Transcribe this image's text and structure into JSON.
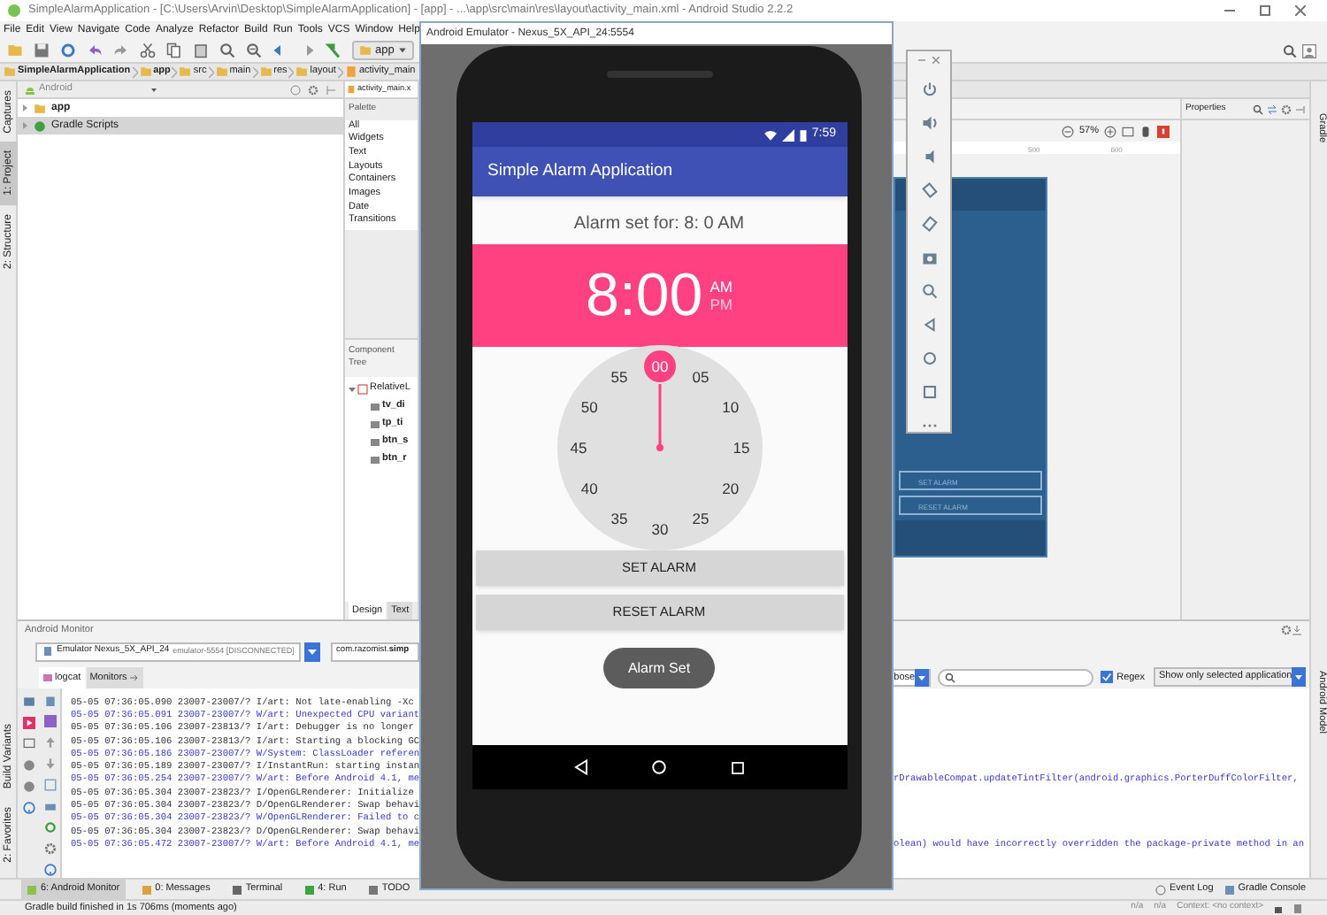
{
  "ide": {
    "title": "SimpleAlarmApplication - [C:\\Users\\Arvin\\Desktop\\SimpleAlarmApplication] - [app] - ...\\app\\src\\main\\res\\layout\\activity_main.xml - Android Studio 2.2.2",
    "menu": [
      "File",
      "Edit",
      "View",
      "Navigate",
      "Code",
      "Analyze",
      "Refactor",
      "Build",
      "Run",
      "Tools",
      "VCS",
      "Window",
      "Help"
    ],
    "run_config": "app",
    "breadcrumbs": [
      "SimpleAlarmApplication",
      "app",
      "src",
      "main",
      "res",
      "layout",
      "activity_main"
    ],
    "left_tool_tabs": [
      {
        "label": "Captures",
        "selected": false
      },
      {
        "label": "1: Project",
        "selected": true
      },
      {
        "label": "2: Structure",
        "selected": false
      }
    ],
    "left_bottom_tool_tabs": [
      {
        "label": "Build Variants",
        "selected": false
      },
      {
        "label": "2: Favorites",
        "selected": false
      }
    ],
    "project_view": "Android",
    "project_tree": [
      {
        "label": "app",
        "expanded": false,
        "selected": false
      },
      {
        "label": "Gradle Scripts",
        "expanded": false,
        "selected": true
      }
    ],
    "editor_tab": "activity_main.x",
    "palette": {
      "title": "Palette",
      "items": [
        "All",
        "Widgets",
        "Text",
        "Layouts",
        "Containers",
        "Images",
        "Date",
        "Transitions"
      ]
    },
    "component_tree": {
      "title": "Component Tree",
      "items": [
        {
          "label": "RelativeL",
          "expanded": true,
          "children": [
            {
              "label": "tv_di"
            },
            {
              "label": "tp_ti"
            },
            {
              "label": "btn_s"
            },
            {
              "label": "btn_r"
            }
          ]
        }
      ]
    },
    "designer_tabs": [
      {
        "label": "Design",
        "selected": true
      },
      {
        "label": "Text",
        "selected": false
      }
    ],
    "zoom": "57%",
    "ruler": [
      "500",
      "600"
    ],
    "blueprint_buttons": [
      "SET ALARM",
      "RESET ALARM"
    ],
    "properties_title": "Properties",
    "right_tool_tabs": [
      "Gradle",
      "Android Model"
    ],
    "monitor": {
      "title": "Android Monitor",
      "device": "Emulator Nexus_5X_API_24",
      "device_detail": "emulator-5554 [DISCONNECTED]",
      "app": "com.razomist.**simp**",
      "tabs": [
        {
          "label": "logcat",
          "selected": true
        },
        {
          "label": "Monitors",
          "selected": false
        }
      ],
      "log_level": "bose",
      "regex": {
        "label": "Regex",
        "checked": true
      },
      "filter": "Show only selected application",
      "log_lines": [
        {
          "kind": "info",
          "text": "05-05 07:36:05.090 23007-23007/? I/art: Not late-enabling -Xc"
        },
        {
          "kind": "warn",
          "text": "05-05 07:36:05.091 23007-23007/? W/art: Unexpected CPU variant"
        },
        {
          "kind": "info",
          "text": "05-05 07:36:05.106 23007-23813/? I/art: Debugger is no longer"
        },
        {
          "kind": "info",
          "text": "05-05 07:36:05.106 23007-23813/? I/art: Starting a blocking GC"
        },
        {
          "kind": "warn",
          "text": "05-05 07:36:05.186 23007-23007/? W/System: ClassLoader referen"
        },
        {
          "kind": "info",
          "text": "05-05 07:36:05.189 23007-23007/? I/InstantRun: starting instan"
        },
        {
          "kind": "warn",
          "text": "05-05 07:36:05.254 23007-23007/? W/art: Before Android 4.1, me",
          "tail": "rDrawableCompat.updateTintFilter(android.graphics.PorterDuffColorFilter,"
        },
        {
          "kind": "info",
          "text": "05-05 07:36:05.304 23007-23823/? I/OpenGLRenderer: Initialize"
        },
        {
          "kind": "info",
          "text": "05-05 07:36:05.304 23007-23823/? D/OpenGLRenderer: Swap behavi"
        },
        {
          "kind": "warn",
          "text": "05-05 07:36:05.304 23007-23823/? W/OpenGLRenderer: Failed to c"
        },
        {
          "kind": "info",
          "text": "05-05 07:36:05.304 23007-23823/? D/OpenGLRenderer: Swap behavi"
        },
        {
          "kind": "warn",
          "text": "05-05 07:36:05.472 23007-23007/? W/art: Before Android 4.1, me",
          "tail": "olean) would have incorrectly overridden the package-private method in an"
        }
      ]
    },
    "bottom_tabs": [
      {
        "label": "6: Android Monitor",
        "selected": true
      },
      {
        "label": "0: Messages",
        "selected": false
      },
      {
        "label": "Terminal",
        "selected": false
      },
      {
        "label": "4: Run",
        "selected": false
      },
      {
        "label": "TODO",
        "selected": false
      }
    ],
    "bottom_right_tabs": [
      "Event Log",
      "Gradle Console"
    ],
    "status": "Gradle build finished in 1s 706ms (moments ago)",
    "status_right": [
      "n/a",
      "n/a",
      "Context: <no context>"
    ]
  },
  "emulator": {
    "title": "Android Emulator - Nexus_5X_API_24:5554",
    "phone": {
      "time": "7:59",
      "app_title": "Simple Alarm Application",
      "alarm_text": "Alarm set for: 8: 0 AM",
      "time_display": "8:00",
      "meridiem": [
        {
          "label": "AM",
          "selected": true
        },
        {
          "label": "PM",
          "selected": false
        }
      ],
      "clock": [
        {
          "label": "00",
          "selected": true
        },
        {
          "label": "05",
          "selected": false
        },
        {
          "label": "10",
          "selected": false
        },
        {
          "label": "15",
          "selected": false
        },
        {
          "label": "20",
          "selected": false
        },
        {
          "label": "25",
          "selected": false
        },
        {
          "label": "30",
          "selected": false
        },
        {
          "label": "35",
          "selected": false
        },
        {
          "label": "40",
          "selected": false
        },
        {
          "label": "45",
          "selected": false
        },
        {
          "label": "50",
          "selected": false
        },
        {
          "label": "55",
          "selected": false
        }
      ],
      "buttons": [
        "SET ALARM",
        "RESET ALARM"
      ],
      "toast": "Alarm Set"
    }
  }
}
